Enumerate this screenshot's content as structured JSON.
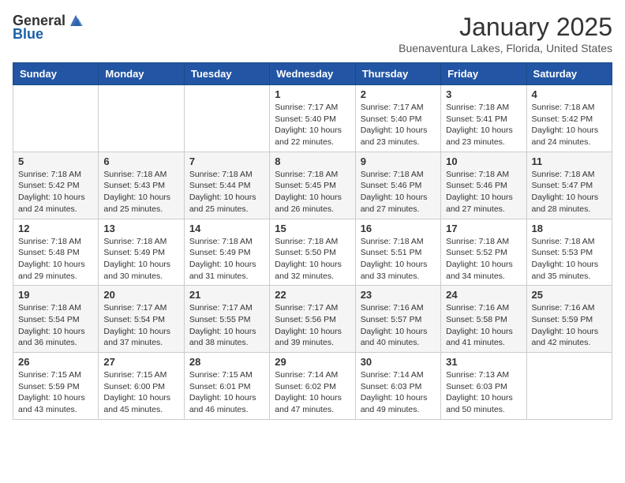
{
  "header": {
    "logo_general": "General",
    "logo_blue": "Blue",
    "month_title": "January 2025",
    "location": "Buenaventura Lakes, Florida, United States"
  },
  "days_of_week": [
    "Sunday",
    "Monday",
    "Tuesday",
    "Wednesday",
    "Thursday",
    "Friday",
    "Saturday"
  ],
  "weeks": [
    {
      "days": [
        {
          "number": "",
          "info": ""
        },
        {
          "number": "",
          "info": ""
        },
        {
          "number": "",
          "info": ""
        },
        {
          "number": "1",
          "info": "Sunrise: 7:17 AM\nSunset: 5:40 PM\nDaylight: 10 hours\nand 22 minutes."
        },
        {
          "number": "2",
          "info": "Sunrise: 7:17 AM\nSunset: 5:40 PM\nDaylight: 10 hours\nand 23 minutes."
        },
        {
          "number": "3",
          "info": "Sunrise: 7:18 AM\nSunset: 5:41 PM\nDaylight: 10 hours\nand 23 minutes."
        },
        {
          "number": "4",
          "info": "Sunrise: 7:18 AM\nSunset: 5:42 PM\nDaylight: 10 hours\nand 24 minutes."
        }
      ]
    },
    {
      "days": [
        {
          "number": "5",
          "info": "Sunrise: 7:18 AM\nSunset: 5:42 PM\nDaylight: 10 hours\nand 24 minutes."
        },
        {
          "number": "6",
          "info": "Sunrise: 7:18 AM\nSunset: 5:43 PM\nDaylight: 10 hours\nand 25 minutes."
        },
        {
          "number": "7",
          "info": "Sunrise: 7:18 AM\nSunset: 5:44 PM\nDaylight: 10 hours\nand 25 minutes."
        },
        {
          "number": "8",
          "info": "Sunrise: 7:18 AM\nSunset: 5:45 PM\nDaylight: 10 hours\nand 26 minutes."
        },
        {
          "number": "9",
          "info": "Sunrise: 7:18 AM\nSunset: 5:46 PM\nDaylight: 10 hours\nand 27 minutes."
        },
        {
          "number": "10",
          "info": "Sunrise: 7:18 AM\nSunset: 5:46 PM\nDaylight: 10 hours\nand 27 minutes."
        },
        {
          "number": "11",
          "info": "Sunrise: 7:18 AM\nSunset: 5:47 PM\nDaylight: 10 hours\nand 28 minutes."
        }
      ]
    },
    {
      "days": [
        {
          "number": "12",
          "info": "Sunrise: 7:18 AM\nSunset: 5:48 PM\nDaylight: 10 hours\nand 29 minutes."
        },
        {
          "number": "13",
          "info": "Sunrise: 7:18 AM\nSunset: 5:49 PM\nDaylight: 10 hours\nand 30 minutes."
        },
        {
          "number": "14",
          "info": "Sunrise: 7:18 AM\nSunset: 5:49 PM\nDaylight: 10 hours\nand 31 minutes."
        },
        {
          "number": "15",
          "info": "Sunrise: 7:18 AM\nSunset: 5:50 PM\nDaylight: 10 hours\nand 32 minutes."
        },
        {
          "number": "16",
          "info": "Sunrise: 7:18 AM\nSunset: 5:51 PM\nDaylight: 10 hours\nand 33 minutes."
        },
        {
          "number": "17",
          "info": "Sunrise: 7:18 AM\nSunset: 5:52 PM\nDaylight: 10 hours\nand 34 minutes."
        },
        {
          "number": "18",
          "info": "Sunrise: 7:18 AM\nSunset: 5:53 PM\nDaylight: 10 hours\nand 35 minutes."
        }
      ]
    },
    {
      "days": [
        {
          "number": "19",
          "info": "Sunrise: 7:18 AM\nSunset: 5:54 PM\nDaylight: 10 hours\nand 36 minutes."
        },
        {
          "number": "20",
          "info": "Sunrise: 7:17 AM\nSunset: 5:54 PM\nDaylight: 10 hours\nand 37 minutes."
        },
        {
          "number": "21",
          "info": "Sunrise: 7:17 AM\nSunset: 5:55 PM\nDaylight: 10 hours\nand 38 minutes."
        },
        {
          "number": "22",
          "info": "Sunrise: 7:17 AM\nSunset: 5:56 PM\nDaylight: 10 hours\nand 39 minutes."
        },
        {
          "number": "23",
          "info": "Sunrise: 7:16 AM\nSunset: 5:57 PM\nDaylight: 10 hours\nand 40 minutes."
        },
        {
          "number": "24",
          "info": "Sunrise: 7:16 AM\nSunset: 5:58 PM\nDaylight: 10 hours\nand 41 minutes."
        },
        {
          "number": "25",
          "info": "Sunrise: 7:16 AM\nSunset: 5:59 PM\nDaylight: 10 hours\nand 42 minutes."
        }
      ]
    },
    {
      "days": [
        {
          "number": "26",
          "info": "Sunrise: 7:15 AM\nSunset: 5:59 PM\nDaylight: 10 hours\nand 43 minutes."
        },
        {
          "number": "27",
          "info": "Sunrise: 7:15 AM\nSunset: 6:00 PM\nDaylight: 10 hours\nand 45 minutes."
        },
        {
          "number": "28",
          "info": "Sunrise: 7:15 AM\nSunset: 6:01 PM\nDaylight: 10 hours\nand 46 minutes."
        },
        {
          "number": "29",
          "info": "Sunrise: 7:14 AM\nSunset: 6:02 PM\nDaylight: 10 hours\nand 47 minutes."
        },
        {
          "number": "30",
          "info": "Sunrise: 7:14 AM\nSunset: 6:03 PM\nDaylight: 10 hours\nand 49 minutes."
        },
        {
          "number": "31",
          "info": "Sunrise: 7:13 AM\nSunset: 6:03 PM\nDaylight: 10 hours\nand 50 minutes."
        },
        {
          "number": "",
          "info": ""
        }
      ]
    }
  ]
}
